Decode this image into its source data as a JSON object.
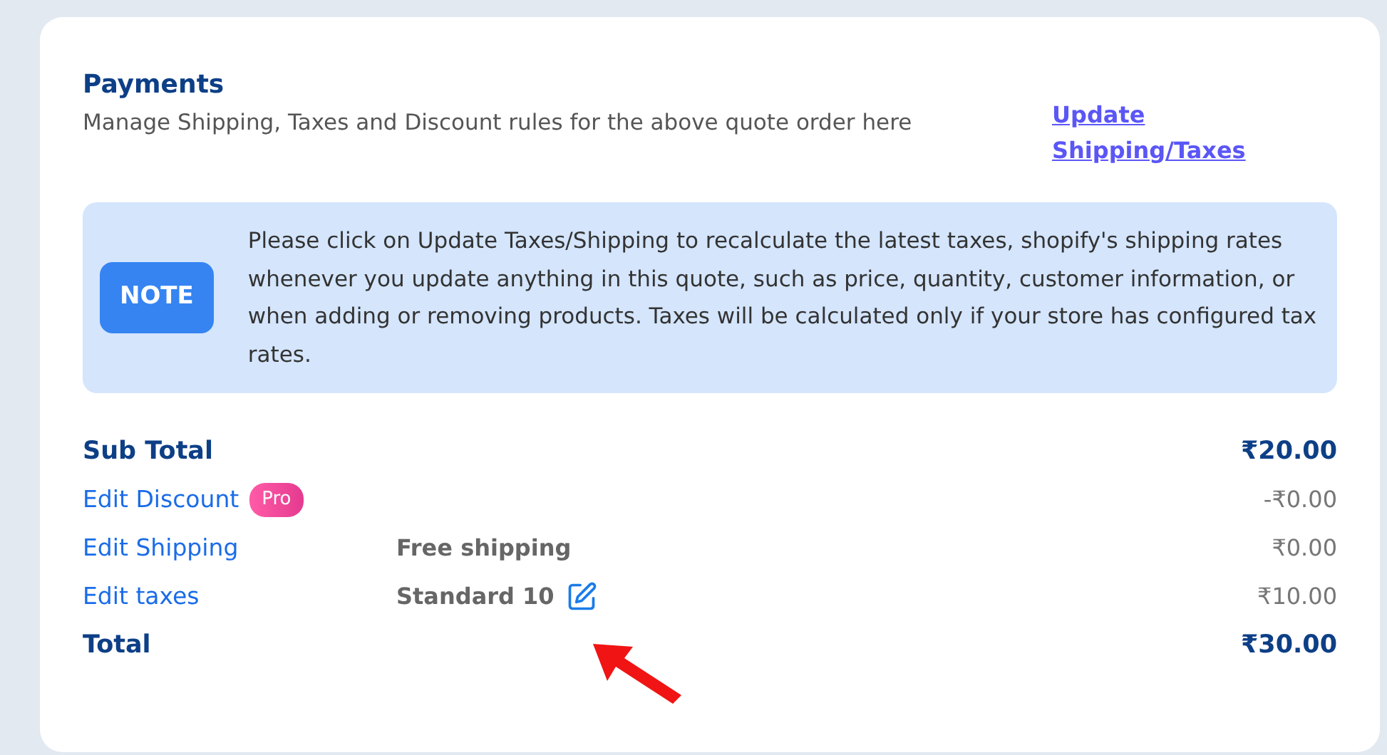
{
  "payments": {
    "title": "Payments",
    "description": "Manage Shipping, Taxes and Discount rules for the above quote order here",
    "update_link": "Update Shipping/Taxes"
  },
  "note": {
    "badge": "NOTE",
    "text": "Please click on Update Taxes/Shipping to recalculate the latest taxes, shopify's shipping rates whenever you update anything in this quote, such as price, quantity, customer information, or when adding or removing products. Taxes will be calculated only if your store has configured tax rates."
  },
  "summary": [
    {
      "kind": "total",
      "label": "Sub Total",
      "amount": "₹20.00"
    },
    {
      "kind": "link",
      "label": "Edit Discount",
      "badge": "Pro",
      "amount": "-₹0.00"
    },
    {
      "kind": "link",
      "label": "Edit Shipping",
      "detail": "Free shipping",
      "amount": "₹0.00"
    },
    {
      "kind": "link",
      "label": "Edit taxes",
      "detail": "Standard 10",
      "editable": true,
      "amount": "₹10.00"
    },
    {
      "kind": "total",
      "label": "Total",
      "amount": "₹30.00"
    }
  ]
}
